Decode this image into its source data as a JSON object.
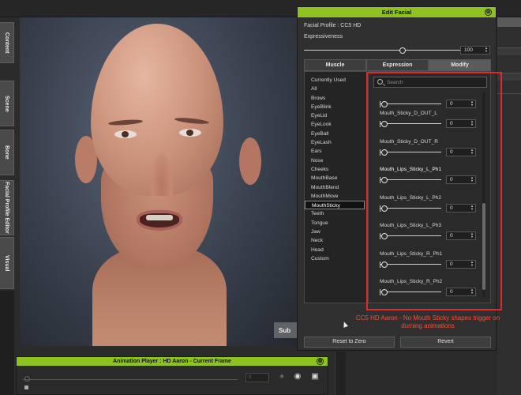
{
  "left_tabs": [
    {
      "label": "Content"
    },
    {
      "label": "Scene"
    },
    {
      "label": "Bone"
    },
    {
      "label": "Facial Profile Editor"
    },
    {
      "label": "Visual"
    }
  ],
  "viewport": {
    "overlay_button": "Sub"
  },
  "dialog": {
    "title": "Edit Facial",
    "close_icon": "⊗",
    "profile": "Facial Profile : CC5 HD",
    "expressiveness_label": "Expressiveness",
    "expressiveness_value": "100",
    "expressiveness_fraction": 0.95,
    "tabs": [
      {
        "label": "Muscle",
        "active": false
      },
      {
        "label": "Expression",
        "active": false
      },
      {
        "label": "Modify",
        "active": true
      }
    ],
    "categories": [
      "Currently Used",
      "All",
      "Brows",
      "EyeBlink",
      "EyeLid",
      "EyeLook",
      "EyeBall",
      "EyeLash",
      "Ears",
      "Nose",
      "Cheeks",
      "MouthBase",
      "MouthBlend",
      "MouthMove",
      "MouthSticky",
      "Teeth",
      "Tongue",
      "Jaw",
      "Neck",
      "Head",
      "Custom"
    ],
    "selected_category": "MouthSticky",
    "search_placeholder": "Search",
    "shapes": [
      {
        "name": "",
        "value": "0"
      },
      {
        "name": "Mouth_Sticky_D_OUT_L",
        "value": "0"
      },
      {
        "name": "Mouth_Sticky_D_OUT_R",
        "value": "0"
      },
      {
        "name": "Mouth_Lips_Sticky_L_Ph1",
        "value": "0"
      },
      {
        "name": "Mouth_Lips_Sticky_L_Ph2",
        "value": "0"
      },
      {
        "name": "Mouth_Lips_Sticky_L_Ph3",
        "value": "0"
      },
      {
        "name": "Mouth_Lips_Sticky_R_Ph1",
        "value": "0"
      },
      {
        "name": "Mouth_Lips_Sticky_R_Ph2",
        "value": "0"
      },
      {
        "name": "",
        "value": "0"
      }
    ],
    "reset_button": "Reset to Zero",
    "revert_button": "Revert"
  },
  "annotation": {
    "text": "CC5 HD Aaron - No Mouth Sticky  shapes trigger on durning animations",
    "color": "#e02a2a"
  },
  "animation_player": {
    "title": "Animation Player : HD Aaron - Current Frame",
    "close_icon": "⊗",
    "frame_value": "0"
  },
  "colors": {
    "accent": "#8ec31f",
    "annotation_red": "#e02a2a"
  }
}
